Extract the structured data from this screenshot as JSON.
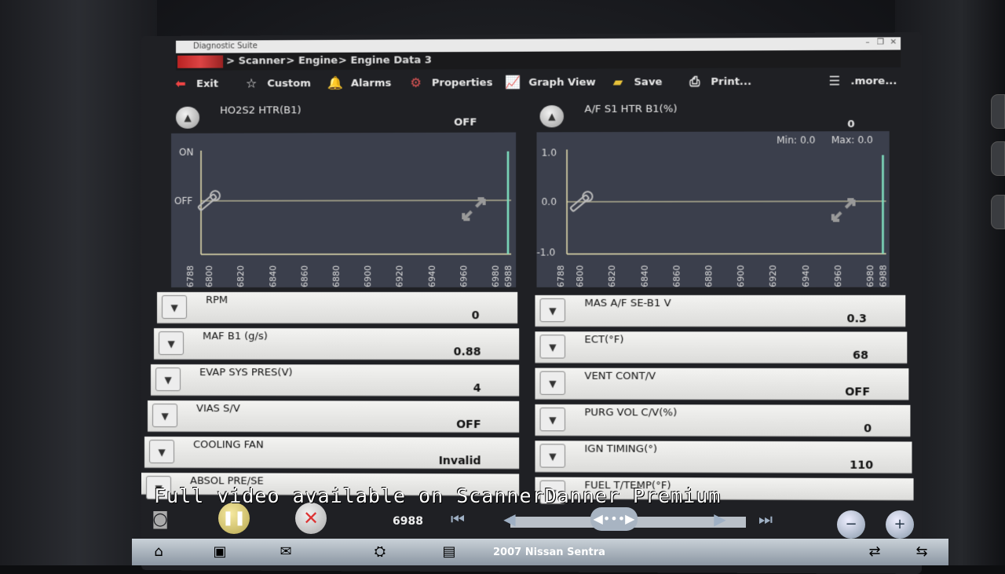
{
  "window": {
    "title": "Diagnostic Suite"
  },
  "breadcrumb": [
    "> Scanner",
    "> Engine",
    "> Engine Data 3"
  ],
  "toolbar": {
    "exit": "Exit",
    "custom": "Custom",
    "alarms": "Alarms",
    "properties": "Properties",
    "graph_view": "Graph View",
    "save": "Save",
    "print": "Print...",
    "more": ".more..."
  },
  "graphs": {
    "left": {
      "label": "HO2S2 HTR(B1)",
      "value": "OFF",
      "y_labels": [
        "ON",
        "OFF"
      ],
      "x_ticks": [
        "6788",
        "6800",
        "6820",
        "6840",
        "6860",
        "6880",
        "6900",
        "6920",
        "6940",
        "6960",
        "6980",
        "6988"
      ]
    },
    "right": {
      "label": "A/F S1 HTR B1(%)",
      "value": "0",
      "min": "Min: 0.0",
      "max": "Max: 0.0",
      "y_labels": [
        "1.0",
        "0.0",
        "-1.0"
      ],
      "x_ticks": [
        "6788",
        "6800",
        "6820",
        "6840",
        "6860",
        "6880",
        "6900",
        "6920",
        "6940",
        "6960",
        "6980",
        "6988"
      ]
    }
  },
  "data_rows": {
    "left": [
      {
        "label": "RPM",
        "value": "0"
      },
      {
        "label": "MAF B1 (g/s)",
        "value": "0.88"
      },
      {
        "label": "EVAP SYS PRES(V)",
        "value": "4"
      },
      {
        "label": "VIAS S/V",
        "value": "OFF"
      },
      {
        "label": "COOLING FAN",
        "value": "Invalid"
      },
      {
        "label": "ABSOL PRE/SE",
        "value": ""
      }
    ],
    "right": [
      {
        "label": "MAS A/F SE-B1 V",
        "value": "0.3"
      },
      {
        "label": "ECT(°F)",
        "value": "68"
      },
      {
        "label": "VENT CONT/V",
        "value": "OFF"
      },
      {
        "label": "PURG VOL C/V(%)",
        "value": "0"
      },
      {
        "label": "IGN TIMING(°)",
        "value": "110"
      },
      {
        "label": "FUEL T/TEMP(°F)",
        "value": ""
      }
    ]
  },
  "playback": {
    "counter": "6988"
  },
  "overlay": {
    "watermark": "Full video available on ScannerDanner Premium"
  },
  "taskbar": {
    "vehicle": "2007 Nissan Sentra"
  },
  "colors": {
    "graph_bg": "#3b3f4c",
    "trace": "#e8e2b0",
    "cursor": "#7fe0c0",
    "row_bg": "#e7e7e5"
  }
}
